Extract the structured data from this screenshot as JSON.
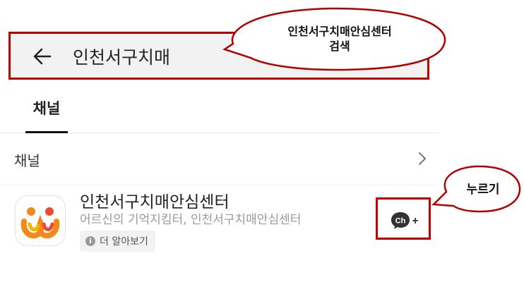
{
  "search": {
    "query": "인천서구치매"
  },
  "tabs": [
    {
      "label": "채널"
    }
  ],
  "section": {
    "title": "채널"
  },
  "result": {
    "name": "인천서구치매안심센터",
    "description": "어르신의 기억지킴터, 인천서구치매안심센터",
    "more_label": "더 알아보기",
    "add_button_glyph": "Ch",
    "add_button_plus": "+"
  },
  "annotations": {
    "search_callout_line1": "인천서구치매안심센터",
    "search_callout_line2": "검색",
    "press_callout": "누르기"
  },
  "colors": {
    "highlight": "#c00000",
    "logo_orange": "#f28a1b",
    "logo_red": "#e84b2e",
    "logo_yellow": "#f7b500"
  }
}
